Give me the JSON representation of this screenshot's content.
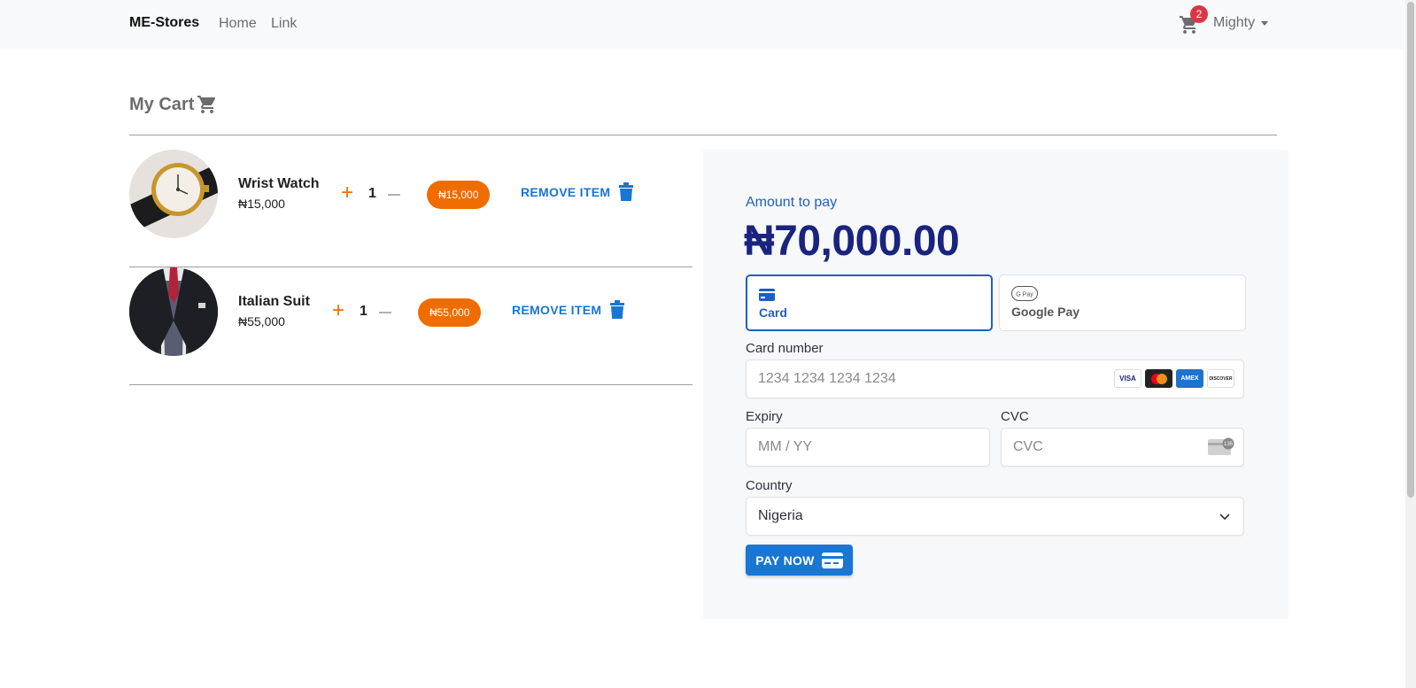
{
  "navbar": {
    "brand": "ME-Stores",
    "links": [
      "Home",
      "Link"
    ],
    "cart_count": "2",
    "user_name": "Mighty"
  },
  "page": {
    "title": "My Cart"
  },
  "cart": {
    "items": [
      {
        "name": "Wrist Watch",
        "price": "₦15,000",
        "quantity": "1",
        "total": "₦15,000",
        "remove_label": "REMOVE ITEM"
      },
      {
        "name": "Italian Suit",
        "price": "₦55,000",
        "quantity": "1",
        "total": "₦55,000",
        "remove_label": "REMOVE ITEM"
      }
    ]
  },
  "payment": {
    "amount_label": "Amount to pay",
    "amount": "₦70,000.00",
    "methods": [
      {
        "label": "Card",
        "icon": "card-icon",
        "selected": true
      },
      {
        "label": "Google Pay",
        "icon": "google-pay-icon",
        "selected": false
      }
    ],
    "card_number_label": "Card number",
    "card_number_placeholder": "1234 1234 1234 1234",
    "card_brands": [
      "VISA",
      "Mastercard",
      "AMEX",
      "DISCOVER"
    ],
    "expiry_label": "Expiry",
    "expiry_placeholder": "MM / YY",
    "cvc_label": "CVC",
    "cvc_placeholder": "CVC",
    "cvc_icon_text": "135",
    "country_label": "Country",
    "country_value": "Nigeria",
    "pay_button": "PAY NOW"
  },
  "colors": {
    "accent": "#1976d2",
    "orange": "#ef6c00",
    "amount": "#1a237e",
    "badge": "#dc3545"
  }
}
